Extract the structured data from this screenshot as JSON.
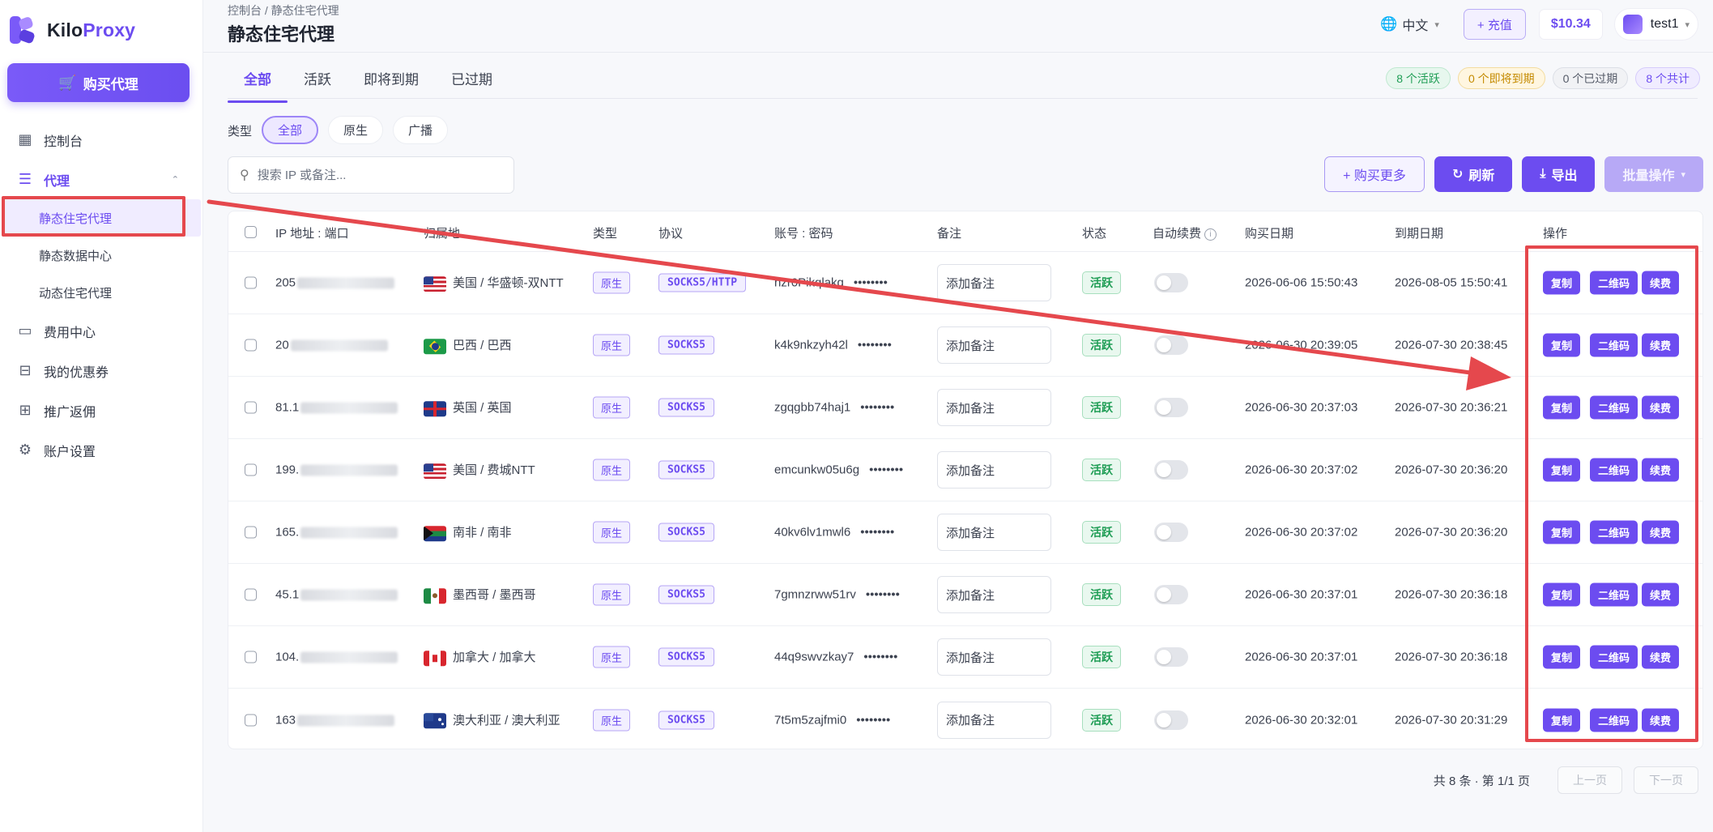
{
  "app": {
    "logo_prefix": "Kilo",
    "logo_suffix": "Proxy",
    "buy_button": "购买代理",
    "accent": "#6c4cf0",
    "highlight": "#e5484d"
  },
  "sidebar": {
    "items": [
      {
        "label": "控制台",
        "icon": "dashboard-icon"
      },
      {
        "label": "代理",
        "icon": "server-icon"
      },
      {
        "label": "静态住宅代理"
      },
      {
        "label": "静态数据中心"
      },
      {
        "label": "动态住宅代理"
      },
      {
        "label": "费用中心",
        "icon": "wallet-icon"
      },
      {
        "label": "我的优惠券",
        "icon": "ticket-icon"
      },
      {
        "label": "推广返佣",
        "icon": "gift-icon"
      },
      {
        "label": "账户设置",
        "icon": "gear-icon"
      }
    ]
  },
  "header": {
    "breadcrumb": "控制台 / 静态住宅代理",
    "title": "静态住宅代理",
    "language": "中文",
    "recharge": "+ 充值",
    "balance": "$10.34",
    "username": "test1"
  },
  "tabs": [
    "全部",
    "活跃",
    "即将到期",
    "已过期"
  ],
  "stats": [
    "8 个活跃",
    "0 个即将到期",
    "0 个已过期",
    "8 个共计"
  ],
  "filter": {
    "label": "类型",
    "options": [
      "全部",
      "原生",
      "广播"
    ]
  },
  "search": {
    "placeholder": "搜索 IP 或备注..."
  },
  "actions": {
    "buy_more": "+ 购买更多",
    "refresh": "刷新",
    "export": "导出",
    "batch": "批量操作"
  },
  "table": {
    "headers": [
      "IP 地址 : 端口",
      "归属地",
      "类型",
      "协议",
      "账号 : 密码",
      "备注",
      "状态",
      "自动续费",
      "购买日期",
      "到期日期",
      "操作"
    ],
    "note_placeholder": "添加备注",
    "op_buttons": [
      "复制",
      "二维码",
      "续费"
    ],
    "rows": [
      {
        "ip": "205",
        "flag": "us",
        "location": "美国 / 华盛顿-双NTT",
        "type": "原生",
        "protocol": "SOCKS5/HTTP",
        "account": "nzr0Pikqlakq",
        "password": "••••••••",
        "status": "活跃",
        "purchase": "2026-06-06 15:50:43",
        "expire": "2026-08-05 15:50:41"
      },
      {
        "ip": "20",
        "flag": "br",
        "location": "巴西 / 巴西",
        "type": "原生",
        "protocol": "SOCKS5",
        "account": "k4k9nkzyh42l",
        "password": "••••••••",
        "status": "活跃",
        "purchase": "2026-06-30 20:39:05",
        "expire": "2026-07-30 20:38:45"
      },
      {
        "ip": "81.1",
        "flag": "gb",
        "location": "英国 / 英国",
        "type": "原生",
        "protocol": "SOCKS5",
        "account": "zgqgbb74haj1",
        "password": "••••••••",
        "status": "活跃",
        "purchase": "2026-06-30 20:37:03",
        "expire": "2026-07-30 20:36:21"
      },
      {
        "ip": "199.",
        "flag": "us",
        "location": "美国 / 费城NTT",
        "type": "原生",
        "protocol": "SOCKS5",
        "account": "emcunkw05u6g",
        "password": "••••••••",
        "status": "活跃",
        "purchase": "2026-06-30 20:37:02",
        "expire": "2026-07-30 20:36:20"
      },
      {
        "ip": "165.",
        "flag": "za",
        "location": "南非 / 南非",
        "type": "原生",
        "protocol": "SOCKS5",
        "account": "40kv6lv1mwl6",
        "password": "••••••••",
        "status": "活跃",
        "purchase": "2026-06-30 20:37:02",
        "expire": "2026-07-30 20:36:20"
      },
      {
        "ip": "45.1",
        "flag": "mx",
        "location": "墨西哥 / 墨西哥",
        "type": "原生",
        "protocol": "SOCKS5",
        "account": "7gmnzrww51rv",
        "password": "••••••••",
        "status": "活跃",
        "purchase": "2026-06-30 20:37:01",
        "expire": "2026-07-30 20:36:18"
      },
      {
        "ip": "104.",
        "flag": "ca",
        "location": "加拿大 / 加拿大",
        "type": "原生",
        "protocol": "SOCKS5",
        "account": "44q9swvzkay7",
        "password": "••••••••",
        "status": "活跃",
        "purchase": "2026-06-30 20:37:01",
        "expire": "2026-07-30 20:36:18"
      },
      {
        "ip": "163",
        "flag": "au",
        "location": "澳大利亚 / 澳大利亚",
        "type": "原生",
        "protocol": "SOCKS5",
        "account": "7t5m5zajfmi0",
        "password": "••••••••",
        "status": "活跃",
        "purchase": "2026-06-30 20:32:01",
        "expire": "2026-07-30 20:31:29"
      }
    ]
  },
  "pagination": {
    "info": "共 8 条 · 第 1/1 页",
    "prev": "上一页",
    "next": "下一页"
  }
}
